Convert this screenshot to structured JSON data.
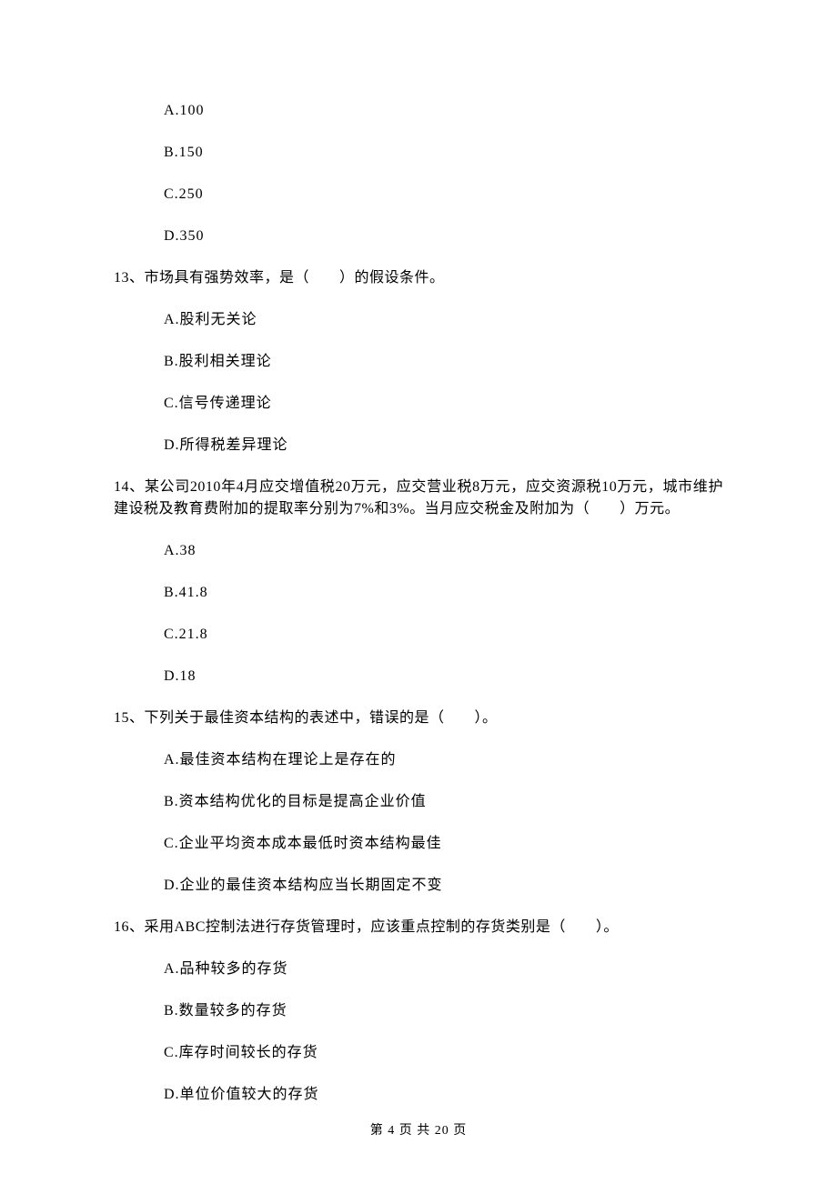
{
  "q12_options": {
    "A": "A.100",
    "B": "B.150",
    "C": "C.250",
    "D": "D.350"
  },
  "q13": {
    "text": "13、市场具有强势效率，是（　　）的假设条件。",
    "options": {
      "A": "A.股利无关论",
      "B": "B.股利相关理论",
      "C": "C.信号传递理论",
      "D": "D.所得税差异理论"
    }
  },
  "q14": {
    "text": "14、某公司2010年4月应交增值税20万元，应交营业税8万元，应交资源税10万元，城市维护建设税及教育费附加的提取率分别为7%和3%。当月应交税金及附加为（　　）万元。",
    "options": {
      "A": "A.38",
      "B": "B.41.8",
      "C": "C.21.8",
      "D": "D.18"
    }
  },
  "q15": {
    "text": "15、下列关于最佳资本结构的表述中，错误的是（　　）。",
    "options": {
      "A": "A.最佳资本结构在理论上是存在的",
      "B": "B.资本结构优化的目标是提高企业价值",
      "C": "C.企业平均资本成本最低时资本结构最佳",
      "D": "D.企业的最佳资本结构应当长期固定不变"
    }
  },
  "q16": {
    "text": "16、采用ABC控制法进行存货管理时，应该重点控制的存货类别是（　　）。",
    "options": {
      "A": "A.品种较多的存货",
      "B": "B.数量较多的存货",
      "C": "C.库存时间较长的存货",
      "D": "D.单位价值较大的存货"
    }
  },
  "footer": "第 4 页 共 20 页"
}
